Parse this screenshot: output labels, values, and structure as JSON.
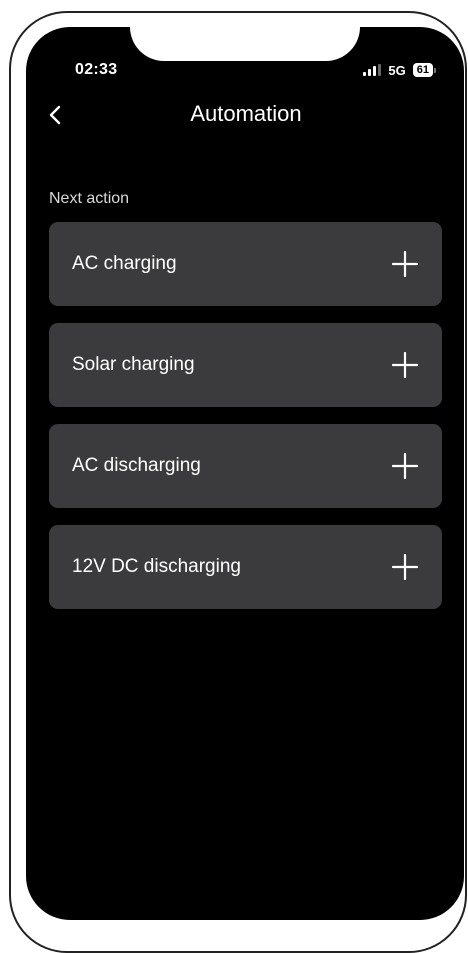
{
  "status_bar": {
    "time": "02:33",
    "network": "5G",
    "battery": "61",
    "signal_icon": "signal-bars-icon",
    "battery_icon": "battery-icon"
  },
  "header": {
    "title": "Automation",
    "back_icon": "chevron-left-icon"
  },
  "section": {
    "label": "Next action"
  },
  "actions": [
    {
      "label": "AC charging",
      "icon": "plus-icon"
    },
    {
      "label": "Solar charging",
      "icon": "plus-icon"
    },
    {
      "label": "AC discharging",
      "icon": "plus-icon"
    },
    {
      "label": "12V DC discharging",
      "icon": "plus-icon"
    }
  ],
  "colors": {
    "background": "#000000",
    "card": "#3b3b3d",
    "text": "#ffffff",
    "muted_text": "#d9d9d9"
  }
}
